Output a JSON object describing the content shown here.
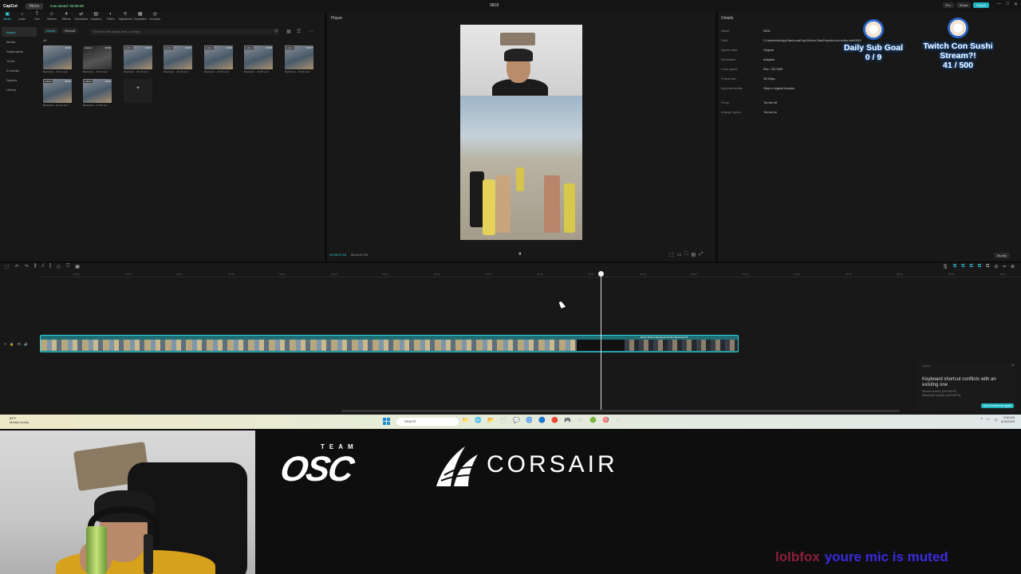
{
  "app": {
    "logo": "CapCut",
    "menu_label": "Menu",
    "autosave": "Auto saved: 02:08:29",
    "project_name": "0818",
    "top_buttons": [
      "Pro",
      "Share",
      "Export"
    ],
    "window_controls": [
      "—",
      "□",
      "✕"
    ]
  },
  "toolbar": {
    "items": [
      {
        "label": "Media",
        "icon": "▣"
      },
      {
        "label": "Audio",
        "icon": "♪"
      },
      {
        "label": "Text",
        "icon": "T"
      },
      {
        "label": "Stickers",
        "icon": "☺"
      },
      {
        "label": "Effects",
        "icon": "✦"
      },
      {
        "label": "Transitions",
        "icon": "⇄"
      },
      {
        "label": "Captions",
        "icon": "▤"
      },
      {
        "label": "Filters",
        "icon": "◐"
      },
      {
        "label": "Adjustment",
        "icon": "⚟"
      },
      {
        "label": "Templates",
        "icon": "▦"
      },
      {
        "label": "AI avatar",
        "icon": "◎"
      }
    ]
  },
  "sidebar": {
    "items": [
      "Import",
      "Media",
      "Subprojects",
      "Yours",
      "AI media",
      "Spaces",
      "Library"
    ]
  },
  "media": {
    "import_label": "Import",
    "record_label": "Record",
    "search_placeholder": "Search for file names, texts, or design",
    "all_label": "All",
    "thumbnails": [
      {
        "name": "Backtrack ...15-41.mp4",
        "duration": "10:00",
        "badge": "",
        "dark": false
      },
      {
        "name": "Backtrack ...05-10.mp4",
        "duration": "00:59",
        "badge": "Added",
        "dark": true
      },
      {
        "name": "Backtrack ...52-43.mp4",
        "duration": "09:37",
        "badge": "Added",
        "dark": false
      },
      {
        "name": "Backtrack ...46-23.mp4",
        "duration": "09:07",
        "badge": "Added",
        "dark": false
      },
      {
        "name": "Backtrack ...40-15.mp4",
        "duration": "10:00",
        "badge": "Added",
        "dark": false
      },
      {
        "name": "Backtrack ...33-25.mp4",
        "duration": "09:58",
        "badge": "Added",
        "dark": false
      },
      {
        "name": "Backtrack ...18-16.mp4",
        "duration": "09:07",
        "badge": "Added",
        "dark": false
      },
      {
        "name": "Backtrack ...36-42.mp4",
        "duration": "09:57",
        "badge": "Added",
        "dark": false
      },
      {
        "name": "Backtrack ...24-56.mp4",
        "duration": "10:00",
        "badge": "Added",
        "dark": false
      },
      {
        "name": "Generate with AI",
        "duration": "",
        "badge": "",
        "dark": true
      }
    ]
  },
  "player": {
    "title": "Player",
    "current_time": "00:09:37:23",
    "total_time": "00:10:07:23",
    "play_icon": "⏸"
  },
  "details": {
    "title": "Details",
    "rows": [
      {
        "label": "Name:",
        "value": "0818"
      },
      {
        "label": "Path:",
        "value": "C:/Users/ichiro/AppData/Local/CapCut/User Data/Projects/com.lveditor.draft/0818"
      },
      {
        "label": "Aspect ratio:",
        "value": "Original"
      },
      {
        "label": "Resolution:",
        "value": "Adapted"
      },
      {
        "label": "Color space:",
        "value": "Rec. 709 SDR"
      },
      {
        "label": "Frame rate:",
        "value": "30.00fps"
      },
      {
        "label": "Imported media:",
        "value": "Stay in original location"
      },
      {
        "label": "Proxy:",
        "value": "Turned off"
      },
      {
        "label": "Arrange layers:",
        "value": "Turned on"
      }
    ],
    "modify_label": "Modify"
  },
  "timeline": {
    "tools": [
      "⬚",
      "↶",
      "↷",
      "⫼",
      "⫽",
      "⫿",
      "◇",
      "⛉",
      "▣"
    ],
    "right_tools": [
      "🎙",
      "⧉",
      "⧉",
      "⧉",
      "⧉",
      "⧉",
      "⊖",
      "━",
      "⊕"
    ],
    "ticks": [
      "00:00",
      "00:30",
      "01:00",
      "01:30",
      "02:00",
      "02:30",
      "03:00",
      "03:30",
      "04:00",
      "04:30",
      "05:00",
      "05:30",
      "06:00",
      "06:30",
      "07:00",
      "07:30",
      "08:00",
      "08:30",
      "09:00"
    ],
    "track_labels": "Backtr  Backtr  Backtrack  Ba  Bac  Backtrack  B",
    "track_icons": [
      "⊟",
      "🔒",
      "👁",
      "🔊"
    ]
  },
  "notification": {
    "header": "Capcut",
    "message": "Keyboard shortcut conflicts with an existing one",
    "sub_line1": "Record screen: [Ctrl+Alt+R]",
    "sub_line2": "Show/hide toolbar: [Ctrl+Alt+R]",
    "button": "Don't remind me again"
  },
  "taskbar": {
    "weather_temp": "84°F",
    "weather_desc": "Mostly cloudy",
    "search_placeholder": "Search",
    "apps": [
      "📁",
      "🌐",
      "📂",
      "🗂",
      "💬",
      "🌀",
      "🔵",
      "🔴",
      "🎮",
      "✉",
      "🟢",
      "🎯",
      "✂"
    ],
    "time": "2:08 AM",
    "date": "8/18/2025"
  },
  "overlay": {
    "team_label": "TEAM",
    "osc_label": "OSC",
    "corsair_label": "CORSAIR",
    "goal1_title": "Daily Sub Goal",
    "goal1_value": "0 / 9",
    "goal2_title_1": "Twitch Con Sushi",
    "goal2_title_2": "Stream?!",
    "goal2_value": "41 / 500",
    "chat_user": "lolbfox",
    "chat_message": "youre mic is muted"
  },
  "colors": {
    "accent": "#2fd3de",
    "export": "#1fb6c1",
    "chat_user": "#8b1f3a",
    "chat_message": "#3a2be0"
  }
}
